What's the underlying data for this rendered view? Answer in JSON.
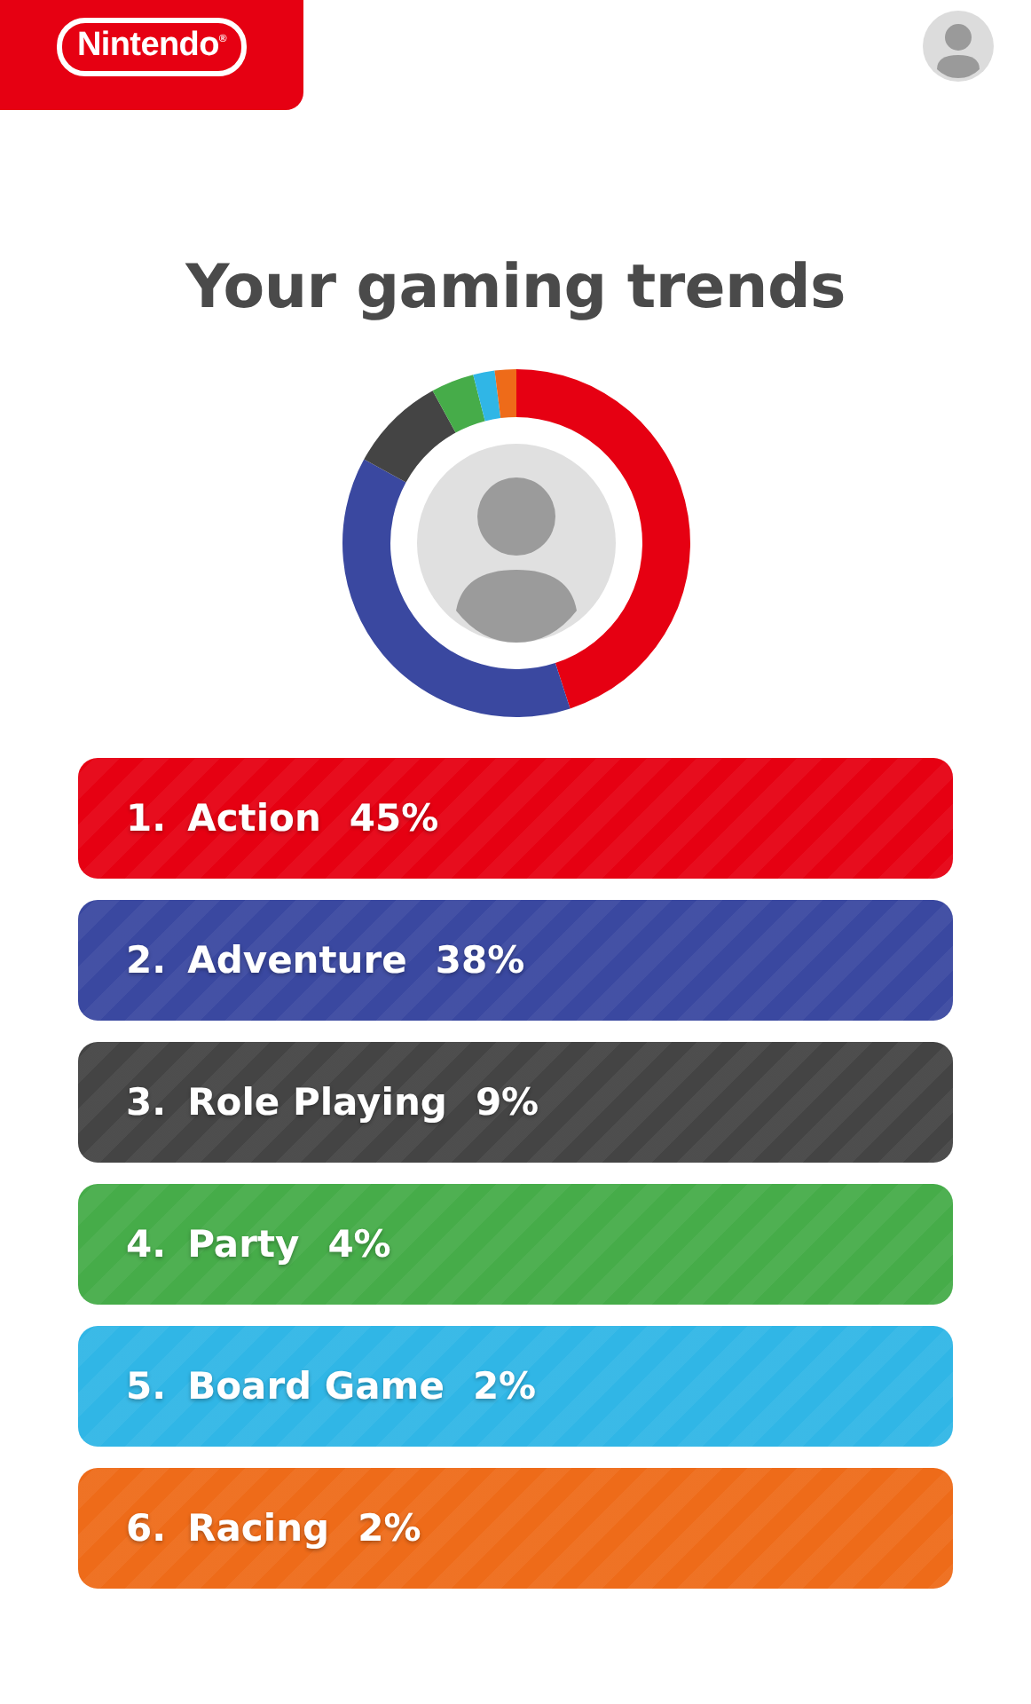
{
  "header": {
    "logo": "Nintendo$^{®}$"
  },
  "title": "Your gaming trends",
  "chart": {
    "chart_data": {
      "type": "donut",
      "values": [
        45,
        38,
        9,
        4,
        2,
        2
      ]
    }
  },
  "genres": [
    {
      "rank": "1.",
      "genre": "Action",
      "percent": "45%",
      "color": "#e60012"
    },
    {
      "rank": "2.",
      "genre": "Adventure",
      "percent": "38%",
      "color": "#3a48a0"
    },
    {
      "rank": "3.",
      "genre": "Role Playing",
      "percent": "9%",
      "color": "#444444"
    },
    {
      "rank": "4.",
      "genre": "Party",
      "percent": "4%",
      "color": "#46ac49"
    },
    {
      "rank": "5.",
      "genre": "Board Game",
      "percent": "2%",
      "color": "#30b6e6"
    },
    {
      "rank": "6.",
      "genre": "Racing",
      "percent": "2%",
      "color": "#ee6b19"
    }
  ]
}
